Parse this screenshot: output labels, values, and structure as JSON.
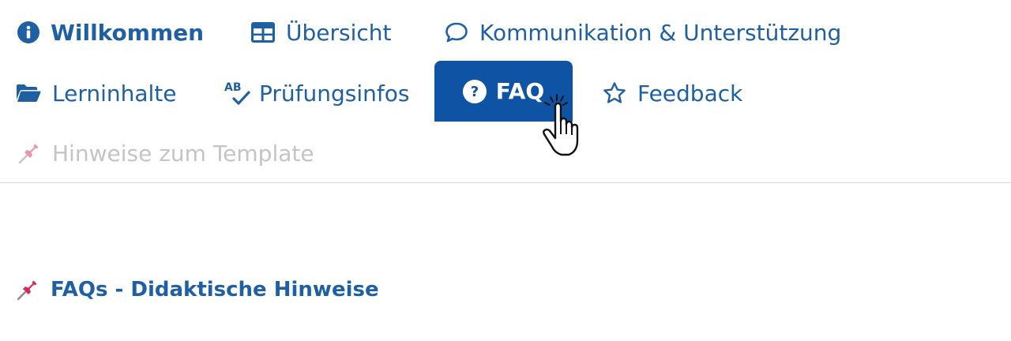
{
  "nav": {
    "row1": [
      {
        "label": "Willkommen",
        "icon": "info-circle-icon"
      },
      {
        "label": "Übersicht",
        "icon": "table-icon"
      },
      {
        "label": "Kommunikation & Unterstützung",
        "icon": "speech-bubble-icon"
      }
    ],
    "row2": [
      {
        "label": "Lerninhalte",
        "icon": "folder-open-icon"
      },
      {
        "label": "Prüfungsinfos",
        "icon": "spellcheck-icon"
      },
      {
        "label": "FAQ",
        "icon": "question-circle-icon",
        "active": true
      },
      {
        "label": "Feedback",
        "icon": "star-icon"
      }
    ],
    "row3": [
      {
        "label": "Hinweise zum Template",
        "icon": "pushpin-icon",
        "disabled": true
      }
    ]
  },
  "content": {
    "heading": "FAQs - Didaktische Hinweise",
    "heading_icon": "pushpin-icon"
  },
  "colors": {
    "accent": "#1f5fa3",
    "active_tab_bg": "#0e53a4",
    "disabled": "#c4c4c4",
    "pin": "#d62d5c"
  }
}
